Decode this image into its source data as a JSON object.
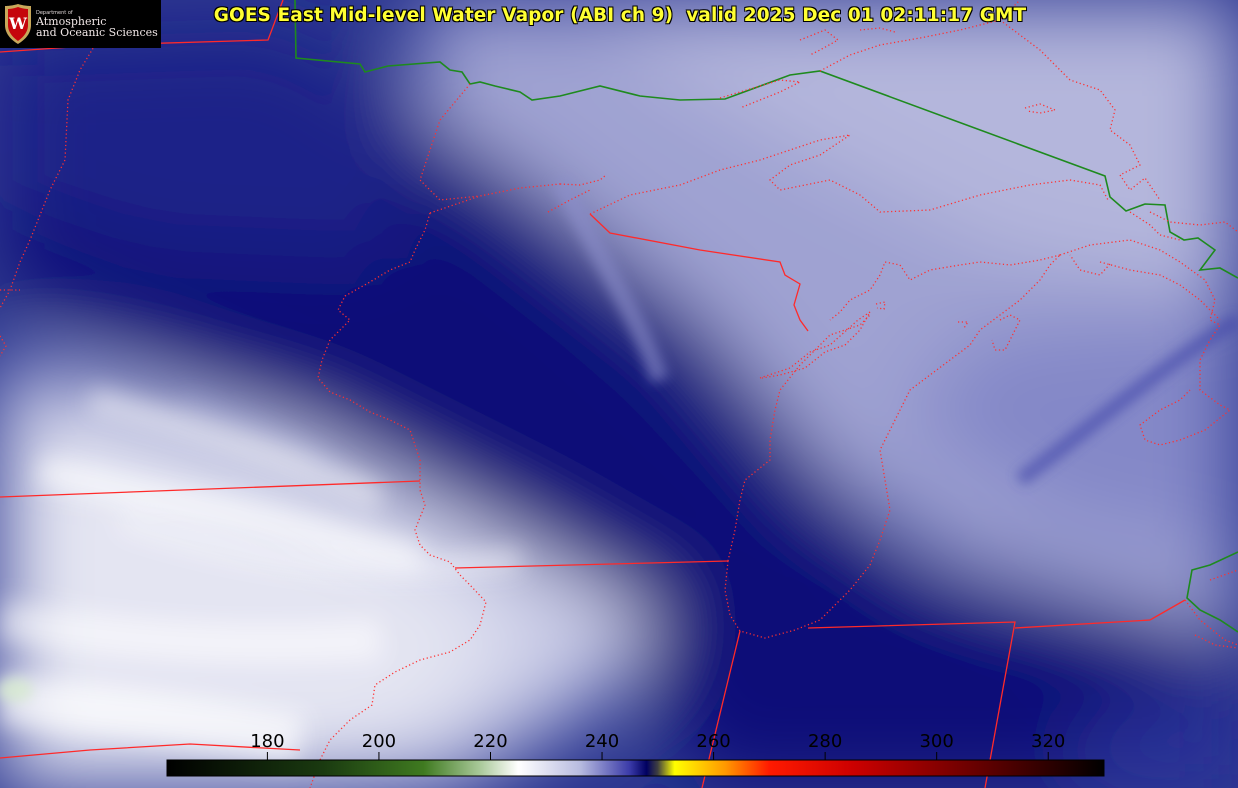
{
  "header": {
    "title": "GOES East Mid-level Water Vapor (ABI ch 9)  valid 2025 Dec 01 02:11:17 GMT"
  },
  "logo": {
    "department": "Department of",
    "line1": "Atmospheric",
    "line2": "and Oceanic Sciences",
    "emblem_letter": "W",
    "emblem_color": "#c5050c"
  },
  "colorbar": {
    "ticks": [
      "180",
      "200",
      "220",
      "240",
      "260",
      "280",
      "300",
      "320"
    ],
    "range": [
      162,
      330
    ],
    "stops": [
      {
        "value": 162,
        "color": "#000000"
      },
      {
        "value": 190,
        "color": "#1a3a10"
      },
      {
        "value": 208,
        "color": "#3f7a20"
      },
      {
        "value": 218,
        "color": "#a8c898"
      },
      {
        "value": 225,
        "color": "#ffffff"
      },
      {
        "value": 236,
        "color": "#b8bce0"
      },
      {
        "value": 245,
        "color": "#3a3aa8"
      },
      {
        "value": 248,
        "color": "#000060"
      },
      {
        "value": 250,
        "color": "#404040"
      },
      {
        "value": 253,
        "color": "#ffff00"
      },
      {
        "value": 262,
        "color": "#ff9a00"
      },
      {
        "value": 270,
        "color": "#ff1a00"
      },
      {
        "value": 285,
        "color": "#cc0000"
      },
      {
        "value": 310,
        "color": "#5a0000"
      },
      {
        "value": 330,
        "color": "#000000"
      }
    ]
  },
  "overlay_colors": {
    "state_borders": "#ff2a2a",
    "international_border": "#1e8a1e",
    "moist_region": "#0a0f78",
    "dry_mid": "#6a6ebc",
    "cloud_white": "#f2f2f8"
  }
}
